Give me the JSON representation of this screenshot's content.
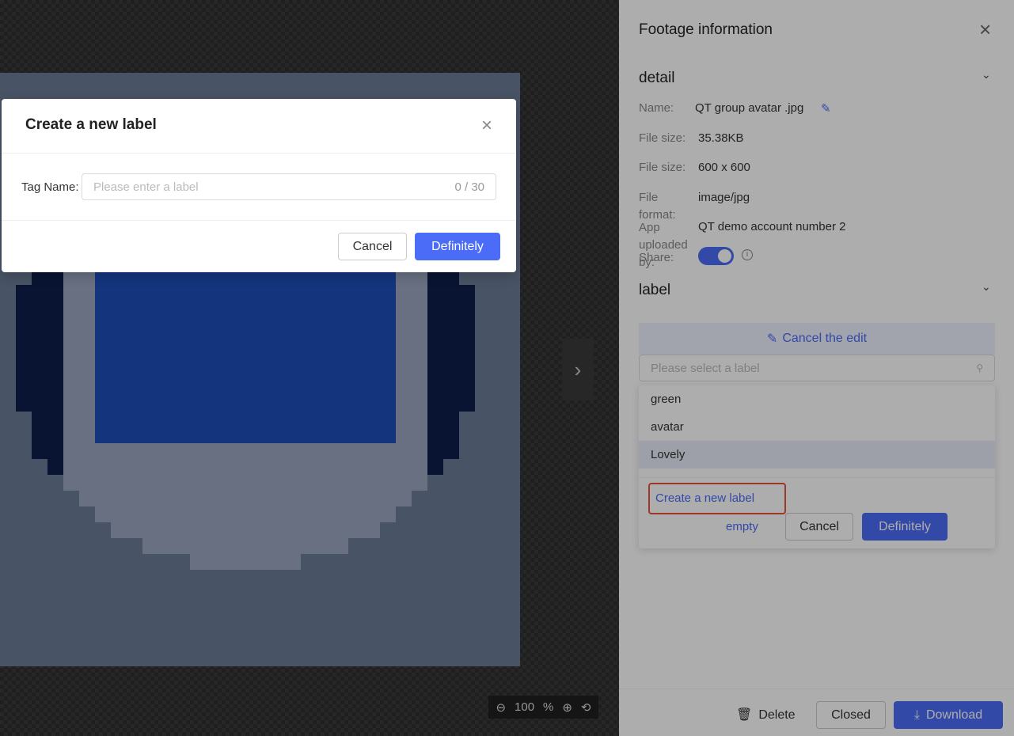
{
  "viewer": {
    "next_icon": "chevron-right-icon",
    "zoom": {
      "zoom_out_icon": "zoom-out-icon",
      "value": "100",
      "unit": "%",
      "zoom_in_icon": "zoom-in-icon",
      "reset_icon": "rotate-icon"
    }
  },
  "panel": {
    "title": "Footage information",
    "detail": {
      "title": "detail",
      "fields": [
        {
          "label": "Name:",
          "value": "QT group avatar .jpg"
        },
        {
          "label": "File size:",
          "value": "35.38KB"
        },
        {
          "label": "File size:",
          "value": "600 x 600"
        },
        {
          "label": "File format:",
          "value": "image/jpg"
        },
        {
          "label": "App uploaded by:",
          "value": "QT demo account number 2"
        },
        {
          "label": "Share:",
          "value": ""
        }
      ],
      "share_enabled": true
    },
    "label": {
      "title": "label",
      "cancel_edit": "Cancel the edit",
      "select_placeholder": "Please select a label",
      "options": [
        "green",
        "avatar",
        "Lovely"
      ],
      "highlighted_option": "Lovely",
      "create_new": "Create a new label",
      "empty": "empty",
      "cancel": "Cancel",
      "confirm": "Definitely"
    },
    "footer": {
      "delete": "Delete",
      "closed": "Closed",
      "download": "Download"
    }
  },
  "modal": {
    "title": "Create a new label",
    "field_label": "Tag Name:",
    "placeholder": "Please enter a label",
    "counter": "0 / 30",
    "cancel": "Cancel",
    "confirm": "Definitely"
  },
  "colors": {
    "accent": "#4a6cf7",
    "highlight_border": "#e8533a"
  }
}
